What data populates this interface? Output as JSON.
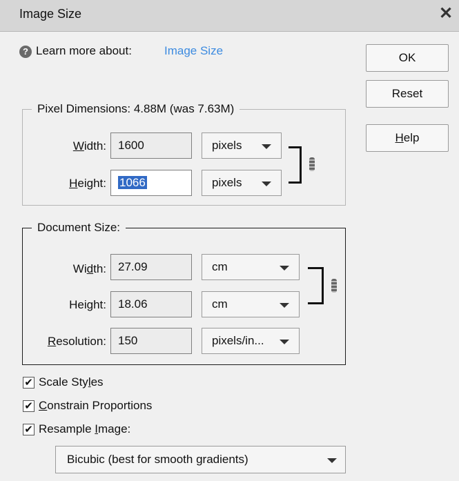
{
  "dialog": {
    "title": "Image Size",
    "close_glyph": "✕",
    "learn_prefix": "Learn more about:",
    "learn_link": "Image Size"
  },
  "buttons": {
    "ok": "OK",
    "reset": "Reset",
    "help_pre": "",
    "help_u": "H",
    "help_post": "elp"
  },
  "pixel_dimensions": {
    "legend": "Pixel Dimensions:  4.88M (was 7.63M)",
    "width_label_u": "W",
    "width_label_post": "idth:",
    "width_value": "1600",
    "width_unit": "pixels",
    "height_label_u": "H",
    "height_label_post": "eight:",
    "height_value": "1066",
    "height_unit": "pixels"
  },
  "document_size": {
    "legend": "Document Size:",
    "width_label_pre": "Wi",
    "width_label_u": "d",
    "width_label_post": "th:",
    "width_value": "27.09",
    "width_unit": "cm",
    "height_label_pre": "Hei",
    "height_label_u": "g",
    "height_label_post": "ht:",
    "height_value": "18.06",
    "height_unit": "cm",
    "resolution_label_u": "R",
    "resolution_label_post": "esolution:",
    "resolution_value": "150",
    "resolution_unit": "pixels/in..."
  },
  "options": {
    "scale_styles_pre": "Scale Sty",
    "scale_styles_u": "l",
    "scale_styles_post": "es",
    "scale_styles_checked": true,
    "constrain_u": "C",
    "constrain_post": "onstrain Proportions",
    "constrain_checked": true,
    "resample_pre": "Resample ",
    "resample_u": "I",
    "resample_post": "mage:",
    "resample_checked": true,
    "resample_method": "Bicubic (best for smooth gradients)",
    "check_glyph": "✔"
  },
  "icons": {
    "help_icon_glyph": "?"
  },
  "colors": {
    "link": "#3d8be0",
    "selection": "#316ac5",
    "titlebar": "#d6d6d6",
    "background": "#f0f0f0"
  }
}
